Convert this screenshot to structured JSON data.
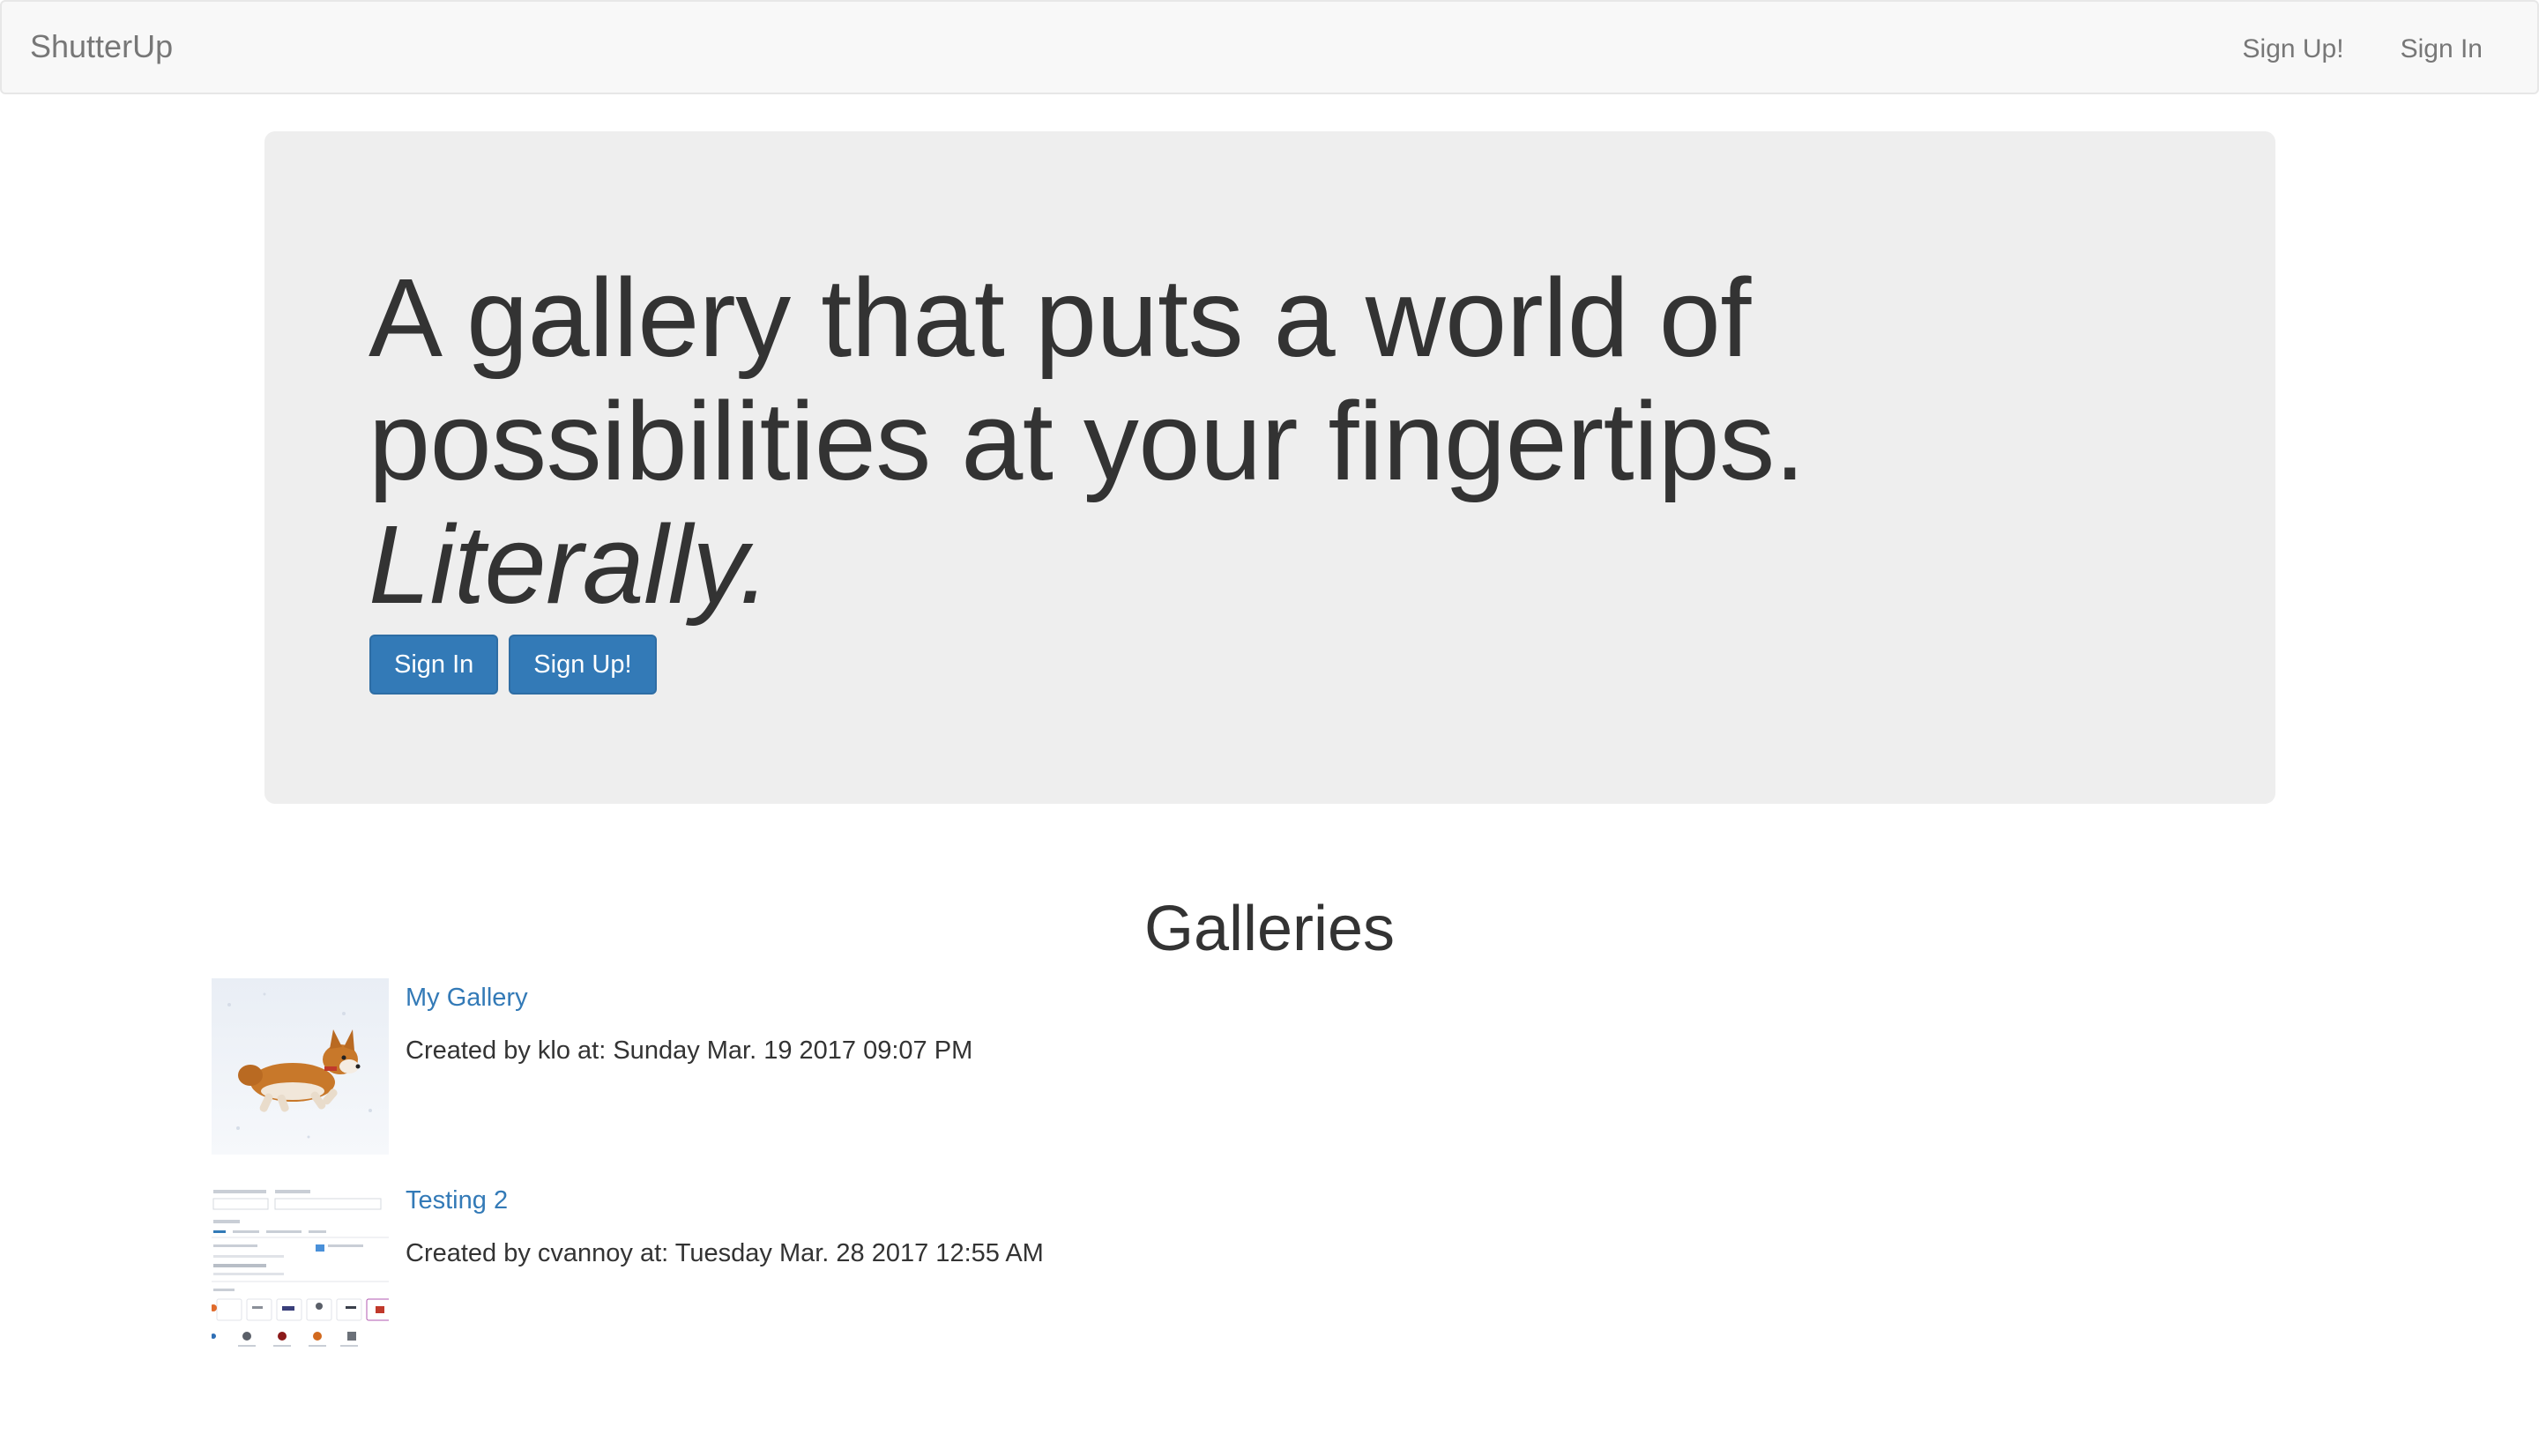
{
  "navbar": {
    "brand": "ShutterUp",
    "links": [
      {
        "label": "Sign Up!"
      },
      {
        "label": "Sign In"
      }
    ]
  },
  "hero": {
    "headline_line1": "A gallery that puts a world of",
    "headline_line2": "possibilities at your fingertips.",
    "headline_emphasis": "Literally.",
    "buttons": [
      {
        "label": "Sign In"
      },
      {
        "label": "Sign Up!"
      }
    ]
  },
  "galleries": {
    "title": "Galleries",
    "items": [
      {
        "name": "My Gallery",
        "meta": "Created by klo at: Sunday Mar. 19 2017 09:07 PM",
        "thumbnail": "corgi-running-in-snow"
      },
      {
        "name": "Testing 2",
        "meta": "Created by cvannoy at: Tuesday Mar. 28 2017 12:55 AM",
        "thumbnail": "screenshot-of-form"
      }
    ]
  },
  "colors": {
    "primary": "#337ab7",
    "navbar_bg": "#f8f8f8",
    "jumbotron_bg": "#eeeeee",
    "text": "#333333",
    "muted": "#777777"
  }
}
